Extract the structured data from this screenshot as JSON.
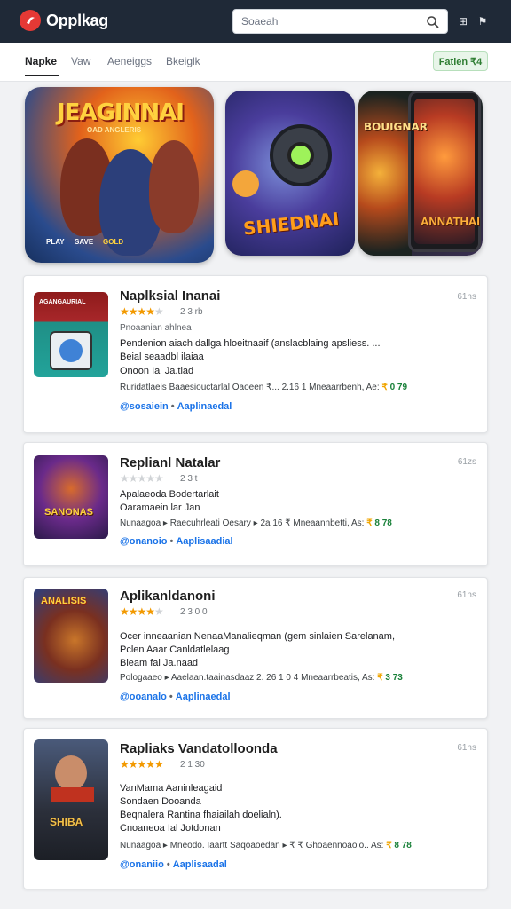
{
  "header": {
    "app_title": "Opplkag",
    "search_placeholder": "Soaeah",
    "icons": [
      "search-icon",
      "grid-icon",
      "bell-icon"
    ],
    "icon_glyphs": [
      "⊞",
      "⚑"
    ]
  },
  "tabs": [
    {
      "label": "Napke",
      "active": true
    },
    {
      "label": "Vaw",
      "active": false
    },
    {
      "label": "Aeneiggs",
      "active": false
    },
    {
      "label": "Bkeiglk",
      "active": false
    }
  ],
  "filter_chip": "Fatien ₹4",
  "banners": [
    {
      "title": "JEAGINNAI",
      "subtitle": "OAD ANGLERIS",
      "tags": [
        "PLAY",
        "SAVE",
        "GOLD"
      ]
    },
    {
      "title": "SHIEDNAI"
    },
    {
      "title": "BOUIGNAR",
      "subtitle": "ANNATHAI"
    }
  ],
  "apps": [
    {
      "title": "Naplksial Inanai",
      "size": "61ns",
      "stars": 4,
      "rating": "2 3 rb",
      "icon_text": "AGANGAURIAL",
      "lines": [
        "Pendenion aiach dallga hloeitnaaif (anslacblaing apsliess. ...",
        "Beial seaadbl ilaiaa",
        "Onoon Ial Ja.tlad"
      ],
      "meta": "Ruridatlaeis  Baaesiouctarlal Oaoeen ₹... 2.16 1 Mneaarrbenh, Ae:",
      "meta_coin": "₹",
      "meta_price": "0 79",
      "links": [
        "@sosaiein",
        "Aaplinaedal"
      ]
    },
    {
      "title": "Replianl Natalar",
      "size": "61zs",
      "stars": 0,
      "rating": "2 3 t",
      "icon_text": "SANONAS",
      "lines": [
        "Apalaeoda Bodertarlait",
        "Oaramaein lar Jan"
      ],
      "meta": "Nunaagoa ▸ Raecuhrleati Oesary ▸ 2a 16 ₹ Mneaannbetti, As:",
      "meta_coin": "₹",
      "meta_price": "8 78",
      "links": [
        "@onanoio",
        "Aaplisaadial"
      ]
    },
    {
      "title": "Aplikanldanoni",
      "size": "61ns",
      "stars": 4,
      "rating": "2 3 0 0",
      "icon_text": "ANALISIS",
      "lines": [
        "Ocer inneaanian NenaaManalieqman (gem sinlaien Sarelanam,",
        "Pclen Aaar Canldatlelaag",
        "Bieam fal Ja.naad"
      ],
      "meta": "Pologaaeo ▸ Aaelaan.taainasdaaz 2. 26 1 0 4 Mneaarrbeatis, As:",
      "meta_coin": "₹",
      "meta_price": "3 73",
      "links": [
        "@ooanalo",
        "Aaplinaedal"
      ]
    },
    {
      "title": "Rapliaks Vandatolloonda",
      "size": "61ns",
      "stars": 5,
      "rating": "2 1 30",
      "icon_text": "SHIBA",
      "lines": [
        "VanMama Aaninleagaid",
        "Sondaen Dooanda",
        "Beqnalera Rantina fhaiailah doelialn).",
        "Cnoaneoa Ial Jotdonan"
      ],
      "meta": "Nunaagoa ▸ Mneodo. Iaartt Saqoaoedan ▸ ₹ ₹ Ghoaennoaoio..  As:",
      "meta_coin": "₹",
      "meta_price": "8 78",
      "links": [
        "@onaniio",
        "Aaplisaadal"
      ]
    }
  ],
  "colors": {
    "header_bg": "#1f2937",
    "accent_red": "#e53935",
    "link_blue": "#1a73e8",
    "star_gold": "#f29900",
    "price_green": "#188038"
  }
}
